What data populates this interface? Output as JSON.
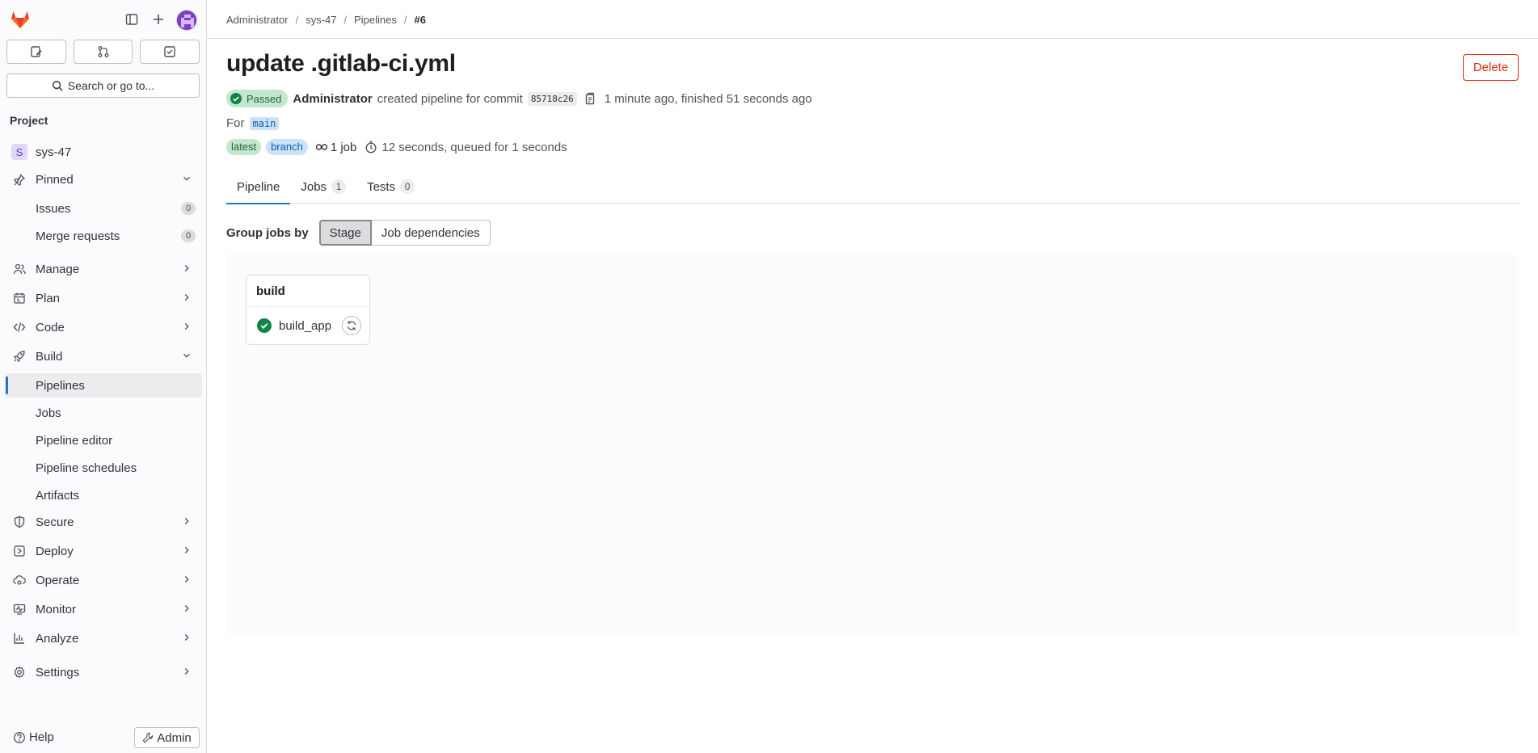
{
  "sidebar": {
    "search_label": "Search or go to...",
    "section_title": "Project",
    "project": {
      "letter": "S",
      "name": "sys-47"
    },
    "pinned_label": "Pinned",
    "pinned_items": [
      {
        "label": "Issues",
        "count": "0"
      },
      {
        "label": "Merge requests",
        "count": "0"
      }
    ],
    "nav": {
      "manage": "Manage",
      "plan": "Plan",
      "code": "Code",
      "build": "Build",
      "secure": "Secure",
      "deploy": "Deploy",
      "operate": "Operate",
      "monitor": "Monitor",
      "analyze": "Analyze",
      "settings": "Settings"
    },
    "build_items": [
      "Pipelines",
      "Jobs",
      "Pipeline editor",
      "Pipeline schedules",
      "Artifacts"
    ],
    "help_label": "Help",
    "admin_label": "Admin"
  },
  "breadcrumb": [
    "Administrator",
    "sys-47",
    "Pipelines",
    "#6"
  ],
  "pipeline": {
    "title": "update .gitlab-ci.yml",
    "delete_label": "Delete",
    "status": "Passed",
    "author": "Administrator",
    "created_text": "created pipeline for commit",
    "commit_sha": "85718c26",
    "time_text": "1 minute ago, finished 51 seconds ago",
    "for_label": "For",
    "ref": "main",
    "badges": [
      "latest",
      "branch"
    ],
    "job_count": "1 job",
    "duration_text": "12 seconds, queued for 1 seconds"
  },
  "tabs": [
    {
      "label": "Pipeline",
      "count": ""
    },
    {
      "label": "Jobs",
      "count": "1"
    },
    {
      "label": "Tests",
      "count": "0"
    }
  ],
  "group_by": {
    "label": "Group jobs by",
    "options": [
      "Stage",
      "Job dependencies"
    ],
    "selected": "Stage"
  },
  "graph": {
    "stage_name": "build",
    "job_name": "build_app",
    "job_status": "success"
  },
  "colors": {
    "accent": "#1f75cb",
    "success": "#108548",
    "danger": "#dd2b0e",
    "brand": "#e24329"
  },
  "icons": {
    "logo": "gitlab-tanuki-icon",
    "sidebar_toggle": "sidebar-toggle-icon",
    "new": "plus-icon",
    "issues": "issues-icon",
    "merge_requests": "merge-request-icon",
    "todos": "todo-icon",
    "search": "search-icon",
    "pin": "pin-icon",
    "copy": "copy-icon",
    "clock": "clock-icon",
    "retry": "retry-icon"
  }
}
